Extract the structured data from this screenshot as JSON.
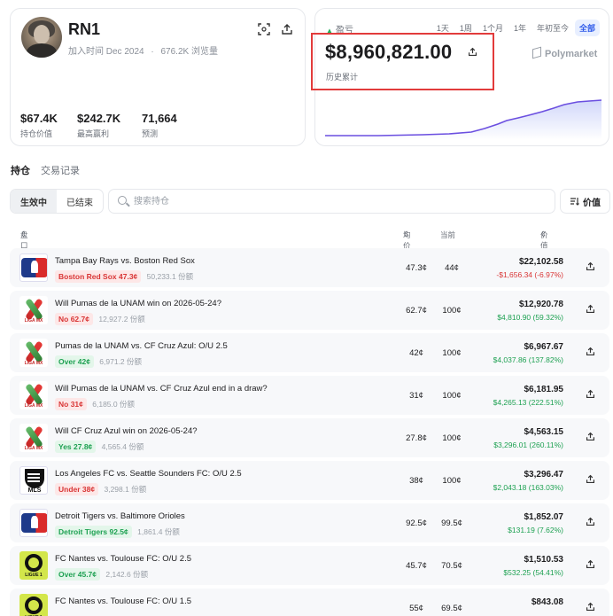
{
  "profile": {
    "username": "RN1",
    "joined": "加入时间 Dec 2024",
    "views": "676.2K 浏览量",
    "stats": [
      {
        "value": "$67.4K",
        "label": "持仓价值"
      },
      {
        "value": "$242.7K",
        "label": "最高赢利"
      },
      {
        "value": "71,664",
        "label": "预测"
      }
    ]
  },
  "pnl": {
    "label": "盈亏",
    "value": "$8,960,821.00",
    "sublabel": "历史累计",
    "brand": "Polymarket",
    "ranges": [
      "1天",
      "1周",
      "1个月",
      "1年",
      "年初至今",
      "全部"
    ],
    "active_range": "全部",
    "line_color": "#6b4fe0"
  },
  "tabs": [
    "持仓",
    "交易记录"
  ],
  "filter": {
    "segments": [
      "生效中",
      "已结束"
    ],
    "search_placeholder": "搜索持仓",
    "sort_label": "价值"
  },
  "table": {
    "headers": {
      "market": "盘口",
      "avg": "均价",
      "current": "当前",
      "value": "价值"
    },
    "rows": [
      {
        "logo": "mlb",
        "title": "Tampa Bay Rays vs. Boston Red Sox",
        "pos": "Boston Red Sox 47.3¢",
        "pos_color": "red",
        "shares": "50,233.1 份额",
        "avg": "47.3¢",
        "cur": "44¢",
        "value": "$22,102.58",
        "change": "-$1,656.34 (-6.97%)",
        "change_sign": "neg"
      },
      {
        "logo": "ligamx",
        "title": "Will Pumas de la UNAM win on 2026-05-24?",
        "pos": "No 62.7¢",
        "pos_color": "red",
        "shares": "12,927.2 份额",
        "avg": "62.7¢",
        "cur": "100¢",
        "value": "$12,920.78",
        "change": "$4,810.90 (59.32%)",
        "change_sign": "pos"
      },
      {
        "logo": "ligamx",
        "title": "Pumas de la UNAM vs. CF Cruz Azul: O/U 2.5",
        "pos": "Over 42¢",
        "pos_color": "green",
        "shares": "6,971.2 份额",
        "avg": "42¢",
        "cur": "100¢",
        "value": "$6,967.67",
        "change": "$4,037.86 (137.82%)",
        "change_sign": "pos"
      },
      {
        "logo": "ligamx",
        "title": "Will Pumas de la UNAM vs. CF Cruz Azul end in a draw?",
        "pos": "No 31¢",
        "pos_color": "red",
        "shares": "6,185.0 份额",
        "avg": "31¢",
        "cur": "100¢",
        "value": "$6,181.95",
        "change": "$4,265.13 (222.51%)",
        "change_sign": "pos"
      },
      {
        "logo": "ligamx",
        "title": "Will CF Cruz Azul win on 2026-05-24?",
        "pos": "Yes 27.8¢",
        "pos_color": "green",
        "shares": "4,565.4 份额",
        "avg": "27.8¢",
        "cur": "100¢",
        "value": "$4,563.15",
        "change": "$3,296.01 (260.11%)",
        "change_sign": "pos"
      },
      {
        "logo": "mls",
        "title": "Los Angeles FC vs. Seattle Sounders FC: O/U 2.5",
        "pos": "Under 38¢",
        "pos_color": "red",
        "shares": "3,298.1 份额",
        "avg": "38¢",
        "cur": "100¢",
        "value": "$3,296.47",
        "change": "$2,043.18 (163.03%)",
        "change_sign": "pos"
      },
      {
        "logo": "mlb",
        "title": "Detroit Tigers vs. Baltimore Orioles",
        "pos": "Detroit Tigers 92.5¢",
        "pos_color": "green",
        "shares": "1,861.4 份额",
        "avg": "92.5¢",
        "cur": "99.5¢",
        "value": "$1,852.07",
        "change": "$131.19 (7.62%)",
        "change_sign": "pos"
      },
      {
        "logo": "ligue1",
        "title": "FC Nantes vs. Toulouse FC: O/U 2.5",
        "pos": "Over 45.7¢",
        "pos_color": "green",
        "shares": "2,142.6 份额",
        "avg": "45.7¢",
        "cur": "70.5¢",
        "value": "$1,510.53",
        "change": "$532.25 (54.41%)",
        "change_sign": "pos"
      },
      {
        "logo": "ligue1",
        "title": "FC Nantes vs. Toulouse FC: O/U 1.5",
        "pos": "",
        "pos_color": "green",
        "shares": "",
        "avg": "55¢",
        "cur": "69.5¢",
        "value": "$843.08",
        "change": "",
        "change_sign": "pos"
      }
    ]
  }
}
